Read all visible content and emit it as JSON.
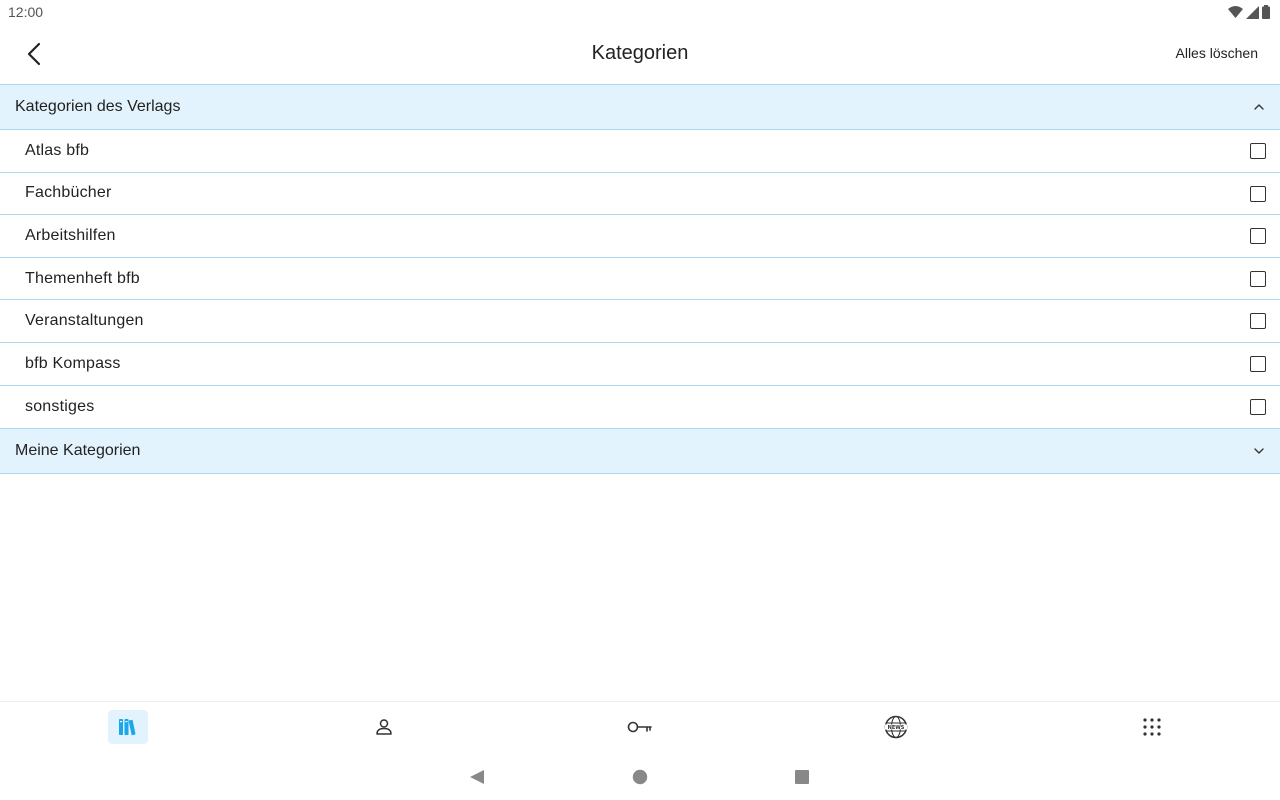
{
  "status_bar": {
    "time": "12:00",
    "icons": [
      "wifi-icon",
      "signal-icon",
      "battery-icon"
    ]
  },
  "app_bar": {
    "title": "Kategorien",
    "clear_all_label": "Alles löschen",
    "back_icon": "arrow-back-icon"
  },
  "publisher_section": {
    "title": "Kategorien des Verlags",
    "expanded": true,
    "items": [
      {
        "label": "Atlas bfb",
        "checked": false
      },
      {
        "label": "Fachbücher",
        "checked": false
      },
      {
        "label": "Arbeitshilfen",
        "checked": false
      },
      {
        "label": "Themenheft bfb",
        "checked": false
      },
      {
        "label": "Veranstaltungen",
        "checked": false
      },
      {
        "label": "bfb Kompass",
        "checked": false
      },
      {
        "label": "sonstiges",
        "checked": false
      }
    ]
  },
  "my_section": {
    "title": "Meine Kategorien",
    "expanded": false
  },
  "bottom_nav": {
    "items": [
      {
        "icon": "library-books-icon",
        "active": true
      },
      {
        "icon": "person-icon",
        "active": false
      },
      {
        "icon": "key-icon",
        "active": false
      },
      {
        "icon": "globe-news-icon",
        "active": false
      },
      {
        "icon": "apps-grid-icon",
        "active": false
      }
    ]
  },
  "colors": {
    "accent": "#1aa7ec",
    "section_bg": "#e3f3fd",
    "divider": "#a9dbf2"
  }
}
